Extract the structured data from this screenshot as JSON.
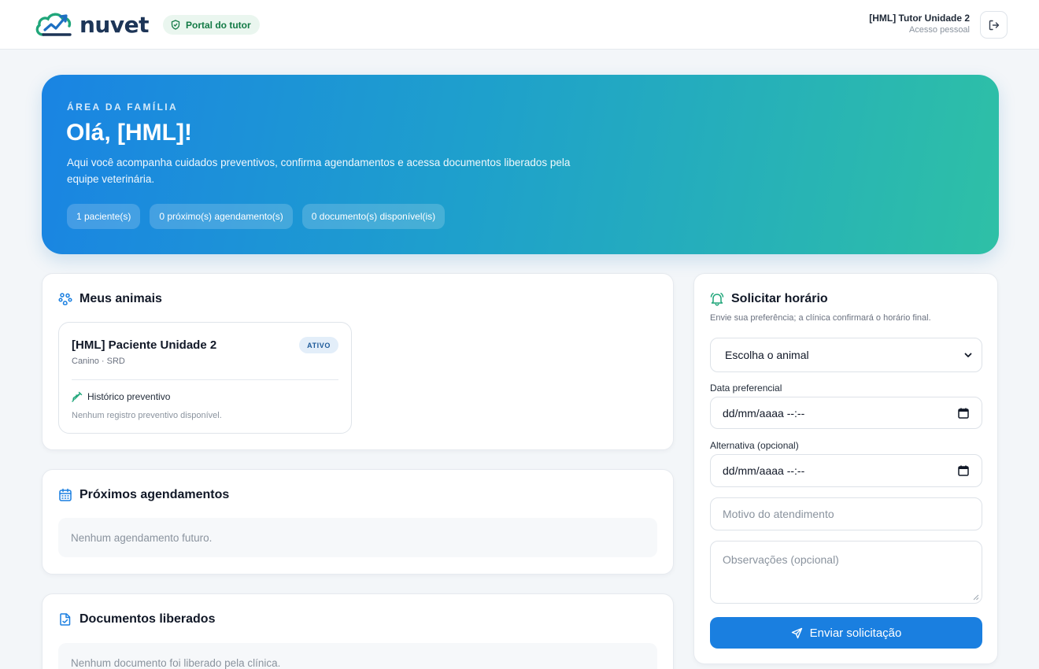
{
  "header": {
    "brand": "nuvet",
    "portal_badge": "Portal do tutor",
    "user_name": "[HML] Tutor Unidade 2",
    "user_subtitle": "Acesso pessoal",
    "icons": {
      "logo": "cloud-chart-logo",
      "badge": "shield-icon",
      "logout": "logout-icon"
    }
  },
  "hero": {
    "kicker": "ÁREA DA FAMÍLIA",
    "title": "Olá, [HML]!",
    "description": "Aqui você acompanha cuidados preventivos, confirma agendamentos e acessa documentos liberados pela equipe veterinária.",
    "pills": [
      "1 paciente(s)",
      "0 próximo(s) agendamento(s)",
      "0 documento(s) disponível(is)"
    ]
  },
  "animals": {
    "title": "Meus animais",
    "icon": "paw-icon",
    "pet": {
      "name": "[HML] Paciente Unidade 2",
      "species": "Canino · SRD",
      "status": "ATIVO",
      "history_title": "Histórico preventivo",
      "history_icon": "syringe-icon",
      "history_empty": "Nenhum registro preventivo disponível."
    }
  },
  "appointments": {
    "title": "Próximos agendamentos",
    "icon": "calendar-icon",
    "empty": "Nenhum agendamento futuro."
  },
  "documents": {
    "title": "Documentos liberados",
    "icon": "document-icon",
    "empty": "Nenhum documento foi liberado pela clínica."
  },
  "request": {
    "title": "Solicitar horário",
    "icon": "bell-icon",
    "subtitle": "Envie sua preferência; a clínica confirmará o horário final.",
    "animal_select": "Escolha o animal",
    "preferred_label": "Data preferencial",
    "preferred_value": "dd/mm/aaaa --:--",
    "alternative_label": "Alternativa (opcional)",
    "alternative_value": "dd/mm/aaaa --:--",
    "reason_placeholder": "Motivo do atendimento",
    "notes_placeholder": "Observações (opcional)",
    "submit_label": "Enviar solicitação",
    "submit_icon": "send-icon"
  },
  "colors": {
    "primary": "#1a7fe0",
    "brand_dark": "#1d3557",
    "brand_green": "#20a67a",
    "hero_gradient_start": "#1a84e3",
    "hero_gradient_end": "#2ec0a6",
    "badge_bg": "#eaf6ef",
    "badge_text": "#127a45"
  }
}
